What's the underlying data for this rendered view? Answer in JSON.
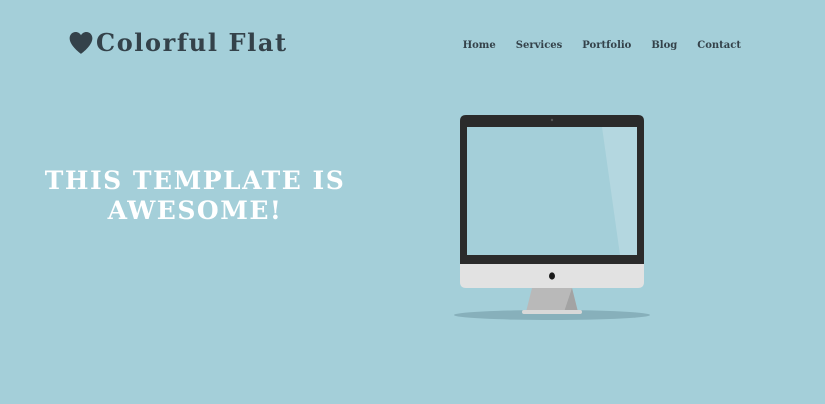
{
  "brand": {
    "name": "Colorful Flat",
    "icon": "heart-icon"
  },
  "nav": {
    "items": [
      {
        "label": "Home"
      },
      {
        "label": "Services"
      },
      {
        "label": "Portfolio"
      },
      {
        "label": "Blog"
      },
      {
        "label": "Contact"
      }
    ]
  },
  "hero": {
    "heading_line1": "THIS TEMPLATE IS",
    "heading_line2": "AWESOME!",
    "illustration": "imac-monitor-icon"
  },
  "colors": {
    "background": "#a4cfd9",
    "text_dark": "#34424a",
    "heading": "#ffffff",
    "screen": "#a4cfd9",
    "bezel": "#2b2b2b"
  }
}
